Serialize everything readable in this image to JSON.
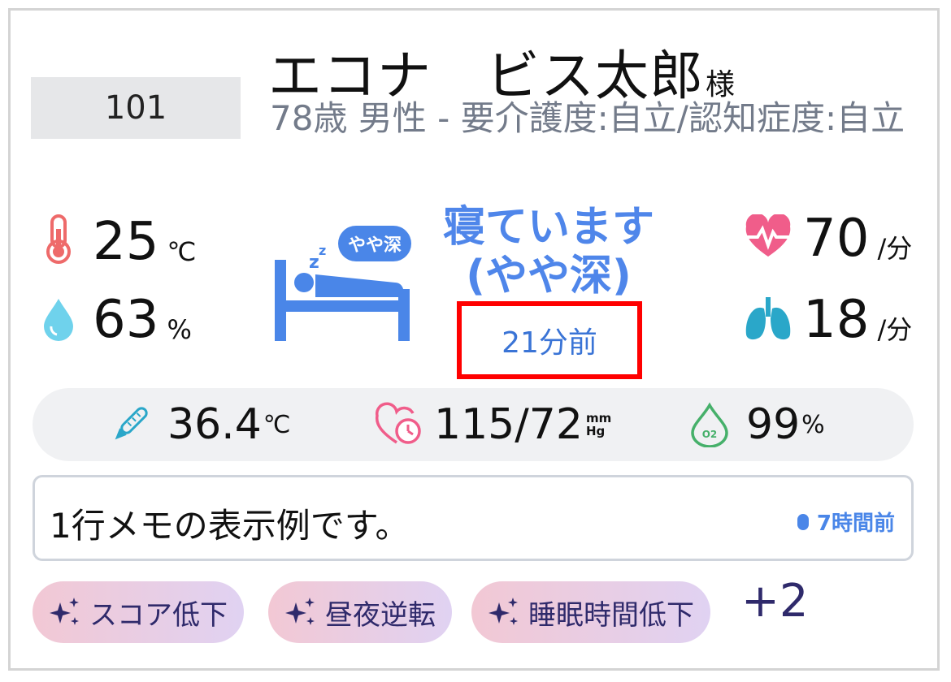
{
  "resident": {
    "room": "101",
    "name": "エコナ　ビス太郎",
    "honorific": "様",
    "details": "78歳 男性 - 要介護度:自立/認知症度:自立"
  },
  "environment": {
    "temperature": {
      "value": "25",
      "unit": "℃",
      "icon": "thermometer-icon"
    },
    "humidity": {
      "value": "63",
      "unit": "%",
      "icon": "water-drop-icon"
    }
  },
  "sleep": {
    "badge": "やや深",
    "status": "寝ています(やや深)",
    "updated": "21分前",
    "icon": "bed-sleep-icon"
  },
  "vitals_right": {
    "heart_rate": {
      "value": "70",
      "unit": "/分",
      "icon": "heart-pulse-icon"
    },
    "respiration": {
      "value": "18",
      "unit": "/分",
      "icon": "lungs-icon"
    }
  },
  "measurements": {
    "body_temp": {
      "value": "36.4",
      "unit": "℃"
    },
    "blood_pressure": {
      "value": "115/72",
      "unit_top": "mm",
      "unit_bottom": "Hg"
    },
    "spo2": {
      "value": "99",
      "unit": "%",
      "icon_label": "O2"
    }
  },
  "memo": {
    "text": "1行メモの表示例です。",
    "time": "7時間前"
  },
  "tags": [
    {
      "label": "スコア低下"
    },
    {
      "label": "昼夜逆転"
    },
    {
      "label": "睡眠時間低下"
    }
  ],
  "more_tags": "+2",
  "colors": {
    "accent_blue": "#4a86e8",
    "alert_red": "#ff0000",
    "tag_text": "#2f2a6b"
  }
}
